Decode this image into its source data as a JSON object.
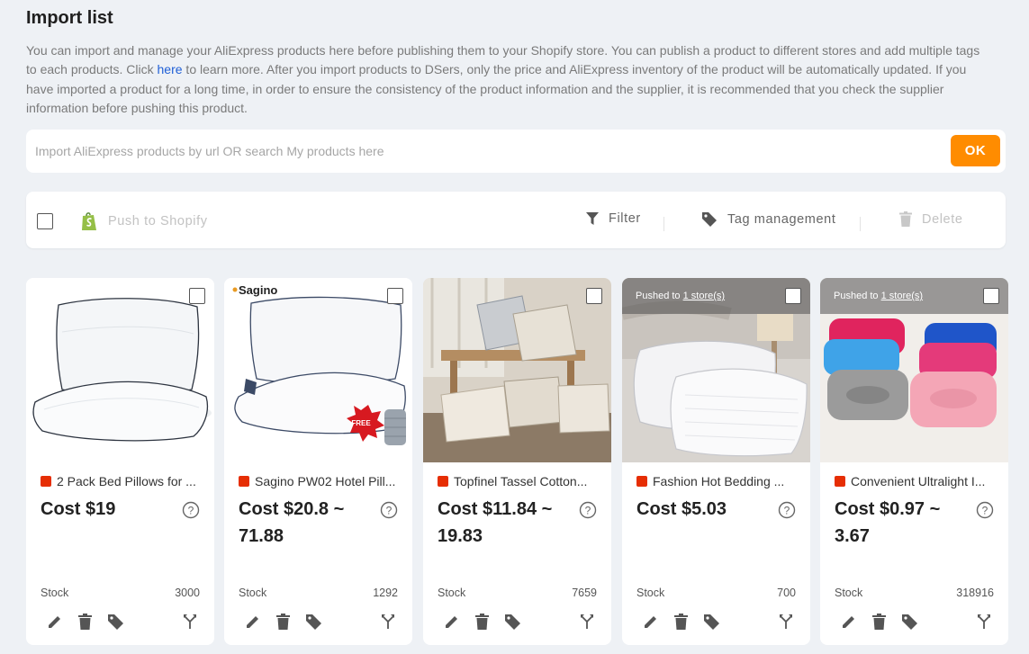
{
  "page": {
    "title": "Import list",
    "description_parts": [
      "You can import and manage your AliExpress products here before publishing them to your Shopify store. You can publish a product to different stores and add multiple tags to each products. Click ",
      "here",
      " to learn more. After you import products to DSers, only the price and AliExpress inventory of the product will be automatically updated. If you have imported a product for a long time, in order to ensure the consistency of the product information and the supplier, it is recommended that you check the supplier information before pushing this product."
    ]
  },
  "search": {
    "placeholder": "Import AliExpress products by url OR search My products here",
    "value": "",
    "ok_label": "OK"
  },
  "toolbar": {
    "push_label": "Push to Shopify",
    "filter_label": "Filter",
    "tag_label": "Tag management",
    "delete_label": "Delete"
  },
  "colors": {
    "accent": "#ff8c00",
    "link": "#1f5fd6",
    "shopify": "#95bf47"
  },
  "products": [
    {
      "name": "2 Pack Bed Pillows for ...",
      "source_icon": "aliexpress-icon",
      "cost": "Cost $19",
      "stock_label": "Stock",
      "stock": "3000",
      "pushed": ""
    },
    {
      "name": "Sagino PW02 Hotel Pill...",
      "source_icon": "aliexpress-choice-icon",
      "cost": "Cost $20.8 ~ 71.88",
      "stock_label": "Stock",
      "stock": "1292",
      "pushed": "",
      "brand": "Sagino",
      "badge_text": "FREE"
    },
    {
      "name": "Topfinel Tassel Cotton...",
      "source_icon": "aliexpress-choice-icon",
      "cost": "Cost $11.84 ~ 19.83",
      "stock_label": "Stock",
      "stock": "7659",
      "pushed": ""
    },
    {
      "name": "Fashion Hot Bedding ...",
      "source_icon": "aliexpress-icon",
      "cost": "Cost $5.03",
      "stock_label": "Stock",
      "stock": "700",
      "pushed_prefix": "Pushed to ",
      "pushed_link": "1 store(s)"
    },
    {
      "name": "Convenient Ultralight I...",
      "source_icon": "aliexpress-icon",
      "cost": "Cost $0.97 ~ 3.67",
      "stock_label": "Stock",
      "stock": "318916",
      "pushed_prefix": "Pushed to ",
      "pushed_link": "1 store(s)"
    }
  ]
}
